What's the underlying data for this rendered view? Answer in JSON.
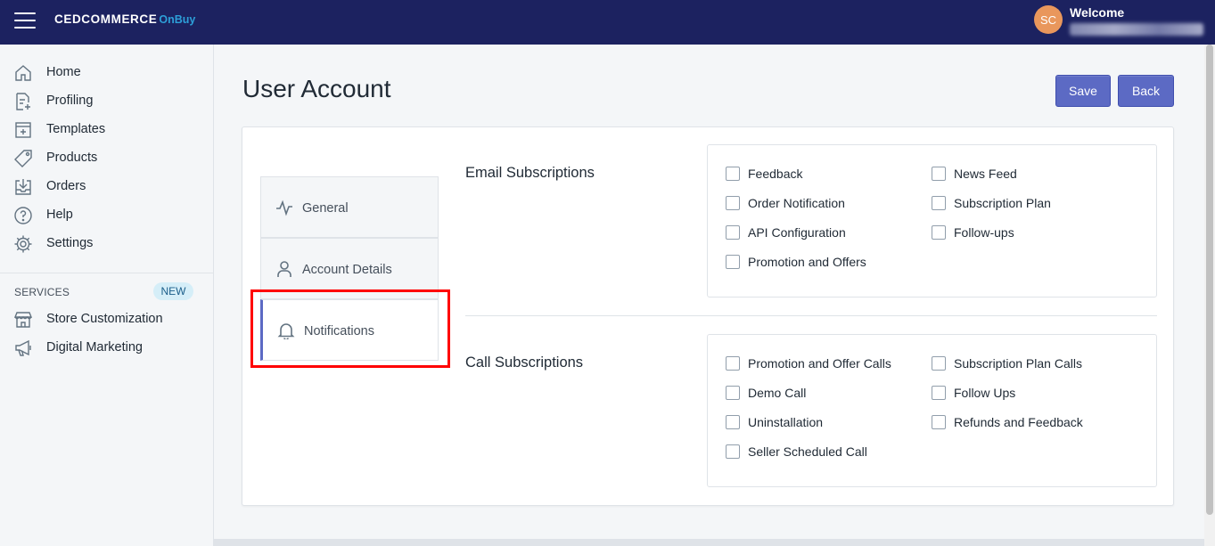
{
  "header": {
    "logo_main": "CEDCOMMERCE",
    "logo_sub": "OnBuy",
    "avatar_initials": "SC",
    "welcome_text": "Welcome"
  },
  "sidebar": {
    "items": [
      {
        "label": "Home",
        "icon": "home-icon"
      },
      {
        "label": "Profiling",
        "icon": "profiling-icon"
      },
      {
        "label": "Templates",
        "icon": "templates-icon"
      },
      {
        "label": "Products",
        "icon": "tag-icon"
      },
      {
        "label": "Orders",
        "icon": "orders-icon"
      },
      {
        "label": "Help",
        "icon": "help-icon"
      },
      {
        "label": "Settings",
        "icon": "gear-icon"
      }
    ],
    "services_label": "SERVICES",
    "new_badge": "NEW",
    "service_items": [
      {
        "label": "Store Customization",
        "icon": "store-icon"
      },
      {
        "label": "Digital Marketing",
        "icon": "megaphone-icon"
      }
    ]
  },
  "page": {
    "title": "User Account",
    "save_label": "Save",
    "back_label": "Back"
  },
  "tabs": [
    {
      "label": "General",
      "icon": "activity-icon"
    },
    {
      "label": "Account Details",
      "icon": "user-icon"
    },
    {
      "label": "Notifications",
      "icon": "bell-icon",
      "active": true
    }
  ],
  "email": {
    "title": "Email Subscriptions",
    "options": [
      "Feedback",
      "News Feed",
      "Order Notification",
      "Subscription Plan",
      "API Configuration",
      "Follow-ups",
      "Promotion and Offers"
    ]
  },
  "call": {
    "title": "Call Subscriptions",
    "options": [
      "Promotion and Offer Calls",
      "Subscription Plan Calls",
      "Demo Call",
      "Follow Ups",
      "Uninstallation",
      "Refunds and Feedback",
      "Seller Scheduled Call"
    ]
  },
  "colors": {
    "topbar": "#1c2260",
    "accent": "#5c6ac4",
    "highlight": "#ff0000",
    "avatar": "#e9975c"
  }
}
